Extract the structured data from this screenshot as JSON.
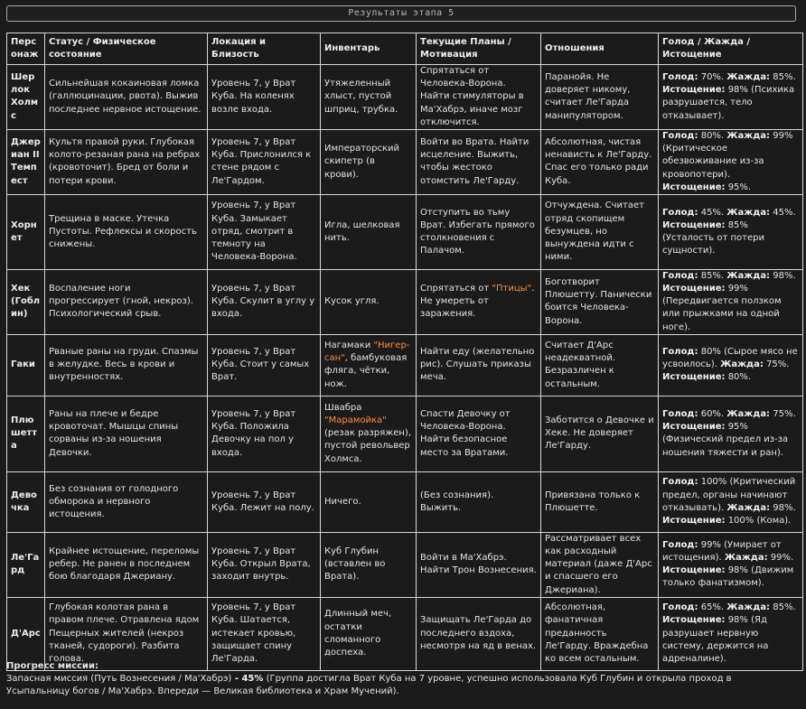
{
  "window": {
    "title": "Результаты этапа 5"
  },
  "table": {
    "headers": [
      "Персонаж",
      "Статус / Физическое состояние",
      "Локация и Близость",
      "Инвентарь",
      "Текущие Планы / Мотивация",
      "Отношения",
      "Голод / Жажда / Истощение"
    ],
    "rows": [
      {
        "name": "Шерлок Холмс",
        "status": "Сильнейшая кокаиновая ломка (галлюцинации, рвота). Выжив последнее нервное истощение.",
        "location": "Уровень 7, у Врат Куба. На коленях возле входа.",
        "inventory": {
          "before": "Утяжеленный хлыст, пустой шприц, трубка.",
          "highlight": "",
          "after": ""
        },
        "plans": {
          "before": "Спрятаться от Человека-Ворона. Найти стимуляторы в Ма'Хабрэ, иначе мозг отключится.",
          "highlight": "",
          "after": ""
        },
        "relations": "Паранойя. Не доверяет никому, считает Ле'Гарда манипулятором.",
        "needs": {
          "hunger": "70%.",
          "thirst": "85%.",
          "exhaustion": "98% (Психика разрушается, тело отказывает)."
        }
      },
      {
        "name": "Джериан II Темпест",
        "status": "Культя правой руки. Глубокая колото-резаная рана на ребрах (кровоточит). Бред от боли и потери крови.",
        "location": "Уровень 7, у Врат Куба. Прислонился к стене рядом с Ле'Гардом.",
        "inventory": {
          "before": "Императорский скипетр (в крови).",
          "highlight": "",
          "after": ""
        },
        "plans": {
          "before": "Войти во Врата. Найти исцеление. Выжить, чтобы жестоко отомстить Ле'Гарду.",
          "highlight": "",
          "after": ""
        },
        "relations": "Абсолютная, чистая ненависть к Ле'Гарду. Спас его только ради Куба.",
        "needs": {
          "hunger": "80%.",
          "thirst": "99% (Критическое обезвоживание из-за кровопотери).",
          "exhaustion": "95%."
        }
      },
      {
        "name": "Хорнет",
        "status": "Трещина в маске. Утечка Пустоты. Рефлексы и скорость снижены.",
        "location": "Уровень 7, у Врат Куба. Замыкает отряд, смотрит в темноту на Человека-Ворона.",
        "inventory": {
          "before": "Игла, шелковая нить.",
          "highlight": "",
          "after": ""
        },
        "plans": {
          "before": "Отступить во тьму Врат. Избегать прямого столкновения с Палачом.",
          "highlight": "",
          "after": ""
        },
        "relations": "Отчуждена. Считает отряд скопищем безумцев, но вынуждена идти с ними.",
        "needs": {
          "hunger": "45%.",
          "thirst": "45%.",
          "exhaustion": "85% (Усталость от потери сущности)."
        }
      },
      {
        "name": "Хек (Гоблин)",
        "status": "Воспаление ноги прогрессирует (гной, некроз). Психологический срыв.",
        "location": "Уровень 7, у Врат Куба. Скулит в углу у входа.",
        "inventory": {
          "before": "Кусок угля.",
          "highlight": "",
          "after": ""
        },
        "plans": {
          "before": "Спрятаться от ",
          "highlight": "\"Птицы\"",
          "after": ". Не умереть от заражения."
        },
        "relations": "Боготворит Плюшетту. Панически боится Человека-Ворона.",
        "needs": {
          "hunger": "85%.",
          "thirst": "98%.",
          "exhaustion": "99% (Передвигается ползком или прыжками на одной ноге)."
        }
      },
      {
        "name": "Гаки",
        "status": "Рваные раны на груди. Спазмы в желудке. Весь в крови и внутренностях.",
        "location": "Уровень 7, у Врат Куба. Стоит у самых Врат.",
        "inventory": {
          "before": "Нагамаки ",
          "highlight": "\"Нигер-сан\"",
          "after": ", бамбуковая фляга, чётки, нож."
        },
        "plans": {
          "before": "Найти еду (желательно рис). Слушать приказы меча.",
          "highlight": "",
          "after": ""
        },
        "relations": "Считает Д'Арс неадекватной. Безразличен к остальным.",
        "needs": {
          "hunger": "80% (Сырое мясо не усвоилось).",
          "thirst": "75%.",
          "exhaustion": "80%."
        }
      },
      {
        "name": "Плюшетта",
        "status": "Раны на плече и бедре кровоточат. Мышцы спины сорваны из-за ношения Девочки.",
        "location": "Уровень 7, у Врат Куба. Положила Девочку на пол у входа.",
        "inventory": {
          "before": "Швабра ",
          "highlight": "\"Марамойка\"",
          "after": " (резак разряжен), пустой револьвер Холмса."
        },
        "plans": {
          "before": "Спасти Девочку от Человека-Ворона. Найти безопасное место за Вратами.",
          "highlight": "",
          "after": ""
        },
        "relations": "Заботится о Девочке и Хеке. Не доверяет Ле'Гарду.",
        "needs": {
          "hunger": "60%.",
          "thirst": "75%.",
          "exhaustion": "95% (Физический предел из-за ношения тяжести и ран)."
        }
      },
      {
        "name": "Девочка",
        "status": "Без сознания от голодного обморока и нервного истощения.",
        "location": "Уровень 7, у Врат Куба. Лежит на полу.",
        "inventory": {
          "before": "Ничего.",
          "highlight": "",
          "after": ""
        },
        "plans": {
          "before": "(Без сознания). Выжить.",
          "highlight": "",
          "after": ""
        },
        "relations": "Привязана только к Плюшетте.",
        "needs": {
          "hunger": "100% (Критический предел, органы начинают отказывать).",
          "thirst": "98%.",
          "exhaustion": "100% (Кома)."
        }
      },
      {
        "name": "Ле'Гард",
        "status": "Крайнее истощение, переломы ребер. Не ранен в последнем бою благодаря Джериану.",
        "location": "Уровень 7, у Врат Куба. Открыл Врата, заходит внутрь.",
        "inventory": {
          "before": "Куб Глубин (вставлен во Врата).",
          "highlight": "",
          "after": ""
        },
        "plans": {
          "before": "Войти в Ма'Хабрэ. Найти Трон Вознесения.",
          "highlight": "",
          "after": ""
        },
        "relations": "Рассматривает всех как расходный материал (даже Д'Арс и спасшего его Джериана).",
        "needs": {
          "hunger": "99% (Умирает от истощения).",
          "thirst": "99%.",
          "exhaustion": "98% (Движим только фанатизмом)."
        }
      },
      {
        "name": "Д'Арс",
        "status": "Глубокая колотая рана в правом плече. Отравлена ядом Пещерных жителей (некроз тканей, судороги). Разбита голова.",
        "location": "Уровень 7, у Врат Куба. Шатается, истекает кровью, защищает спину Ле'Гарда.",
        "inventory": {
          "before": "Длинный меч, остатки сломанного доспеха.",
          "highlight": "",
          "after": ""
        },
        "plans": {
          "before": "Защищать Ле'Гарда до последнего вздоха, несмотря на яд в венах.",
          "highlight": "",
          "after": ""
        },
        "relations": "Абсолютная, фанатичная преданность Ле'Гарду. Враждебна ко всем остальным.",
        "needs": {
          "hunger": "65%.",
          "thirst": "85%.",
          "exhaustion": "98% (Яд разрушает нервную систему, держится на адреналине)."
        }
      }
    ],
    "labels": {
      "hunger": "Голод:",
      "thirst": "Жажда:",
      "exhaustion": "Истощение:"
    }
  },
  "progress": {
    "title": "Прогресс миссии:",
    "mission": "Запасная миссия (Путь Вознесения / Ма'Хабрэ)",
    "separator": " - ",
    "percent": "45%",
    "details": " (Группа достигла Врат Куба на 7 уровне, успешно использовала Куб Глубин и открыла проход в Усыпальницу богов / Ма'Хабрэ. Впереди — Великая библиотека и Храм Мучений)."
  }
}
